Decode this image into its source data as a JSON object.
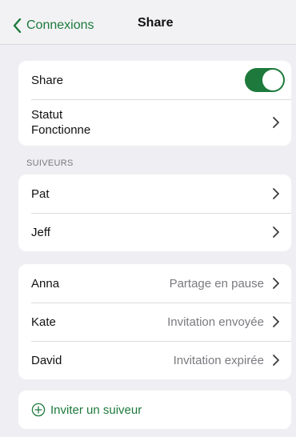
{
  "nav": {
    "back_label": "Connexions",
    "title": "Share"
  },
  "settings": {
    "share_label": "Share",
    "share_enabled": true,
    "status_line1": "Statut",
    "status_line2": "Fonctionne"
  },
  "section_title": "SUIVEURS",
  "followers": [
    {
      "name": "Pat"
    },
    {
      "name": "Jeff"
    }
  ],
  "invites": [
    {
      "name": "Anna",
      "status": "Partage en pause"
    },
    {
      "name": "Kate",
      "status": "Invitation envoyée"
    },
    {
      "name": "David",
      "status": "Invitation expirée"
    }
  ],
  "invite_action": "Inviter un suiveur",
  "colors": {
    "accent": "#1d7a3c",
    "background": "#efeff3",
    "secondary_text": "#7a7a80"
  }
}
